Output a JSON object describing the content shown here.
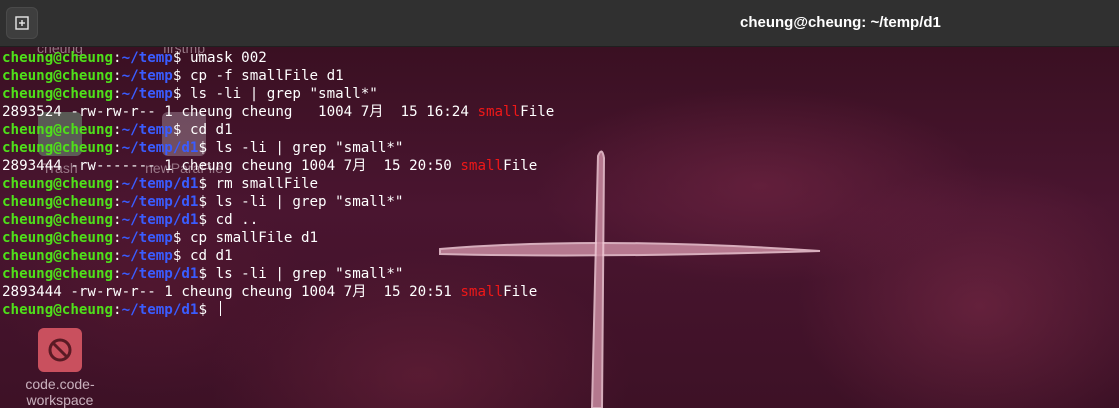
{
  "window": {
    "title": "cheung@cheung: ~/temp/d1"
  },
  "desktop_icons": [
    {
      "label": "cheung",
      "icon": "folder-icon"
    },
    {
      "label": "firstmp",
      "icon": "file-icon"
    },
    {
      "label": "Trash",
      "icon": "trash-icon"
    },
    {
      "label": "newParaFile",
      "icon": "file-icon"
    },
    {
      "label": "code.code-workspace",
      "icon": "no-entry-icon"
    }
  ],
  "terminal": {
    "lines": [
      {
        "type": "prompt",
        "user": "cheung@cheung",
        "colon": ":",
        "path": "~/temp",
        "sym": "$ ",
        "cmd": "umask 002"
      },
      {
        "type": "prompt",
        "user": "cheung@cheung",
        "colon": ":",
        "path": "~/temp",
        "sym": "$ ",
        "cmd": "cp -f smallFile d1"
      },
      {
        "type": "prompt",
        "user": "cheung@cheung",
        "colon": ":",
        "path": "~/temp",
        "sym": "$ ",
        "cmd": "ls -li | grep \"small*\""
      },
      {
        "type": "output",
        "pre": "2893524 -rw-rw-r-- 1 cheung cheung   1004 7月  15 16:24 ",
        "hl": "small",
        "post": "File"
      },
      {
        "type": "prompt",
        "user": "cheung@cheung",
        "colon": ":",
        "path": "~/temp",
        "sym": "$ ",
        "cmd": "cd d1"
      },
      {
        "type": "prompt",
        "user": "cheung@cheung",
        "colon": ":",
        "path": "~/temp/d1",
        "sym": "$ ",
        "cmd": "ls -li | grep \"small*\""
      },
      {
        "type": "output",
        "pre": "2893444 -rw------- 1 cheung cheung 1004 7月  15 20:50 ",
        "hl": "small",
        "post": "File"
      },
      {
        "type": "prompt",
        "user": "cheung@cheung",
        "colon": ":",
        "path": "~/temp/d1",
        "sym": "$ ",
        "cmd": "rm smallFile"
      },
      {
        "type": "prompt",
        "user": "cheung@cheung",
        "colon": ":",
        "path": "~/temp/d1",
        "sym": "$ ",
        "cmd": "ls -li | grep \"small*\""
      },
      {
        "type": "prompt",
        "user": "cheung@cheung",
        "colon": ":",
        "path": "~/temp/d1",
        "sym": "$ ",
        "cmd": "cd .."
      },
      {
        "type": "prompt",
        "user": "cheung@cheung",
        "colon": ":",
        "path": "~/temp",
        "sym": "$ ",
        "cmd": "cp smallFile d1"
      },
      {
        "type": "prompt",
        "user": "cheung@cheung",
        "colon": ":",
        "path": "~/temp",
        "sym": "$ ",
        "cmd": "cd d1"
      },
      {
        "type": "prompt",
        "user": "cheung@cheung",
        "colon": ":",
        "path": "~/temp/d1",
        "sym": "$ ",
        "cmd": "ls -li | grep \"small*\""
      },
      {
        "type": "output",
        "pre": "2893444 -rw-rw-r-- 1 cheung cheung 1004 7月  15 20:51 ",
        "hl": "small",
        "post": "File"
      },
      {
        "type": "prompt",
        "user": "cheung@cheung",
        "colon": ":",
        "path": "~/temp/d1",
        "sym": "$ ",
        "cmd": ""
      }
    ]
  },
  "colors": {
    "user": "#4fe01a",
    "path": "#3a5cff",
    "highlight": "#f01818",
    "titlebar": "#303030",
    "background": "#3a1022"
  }
}
